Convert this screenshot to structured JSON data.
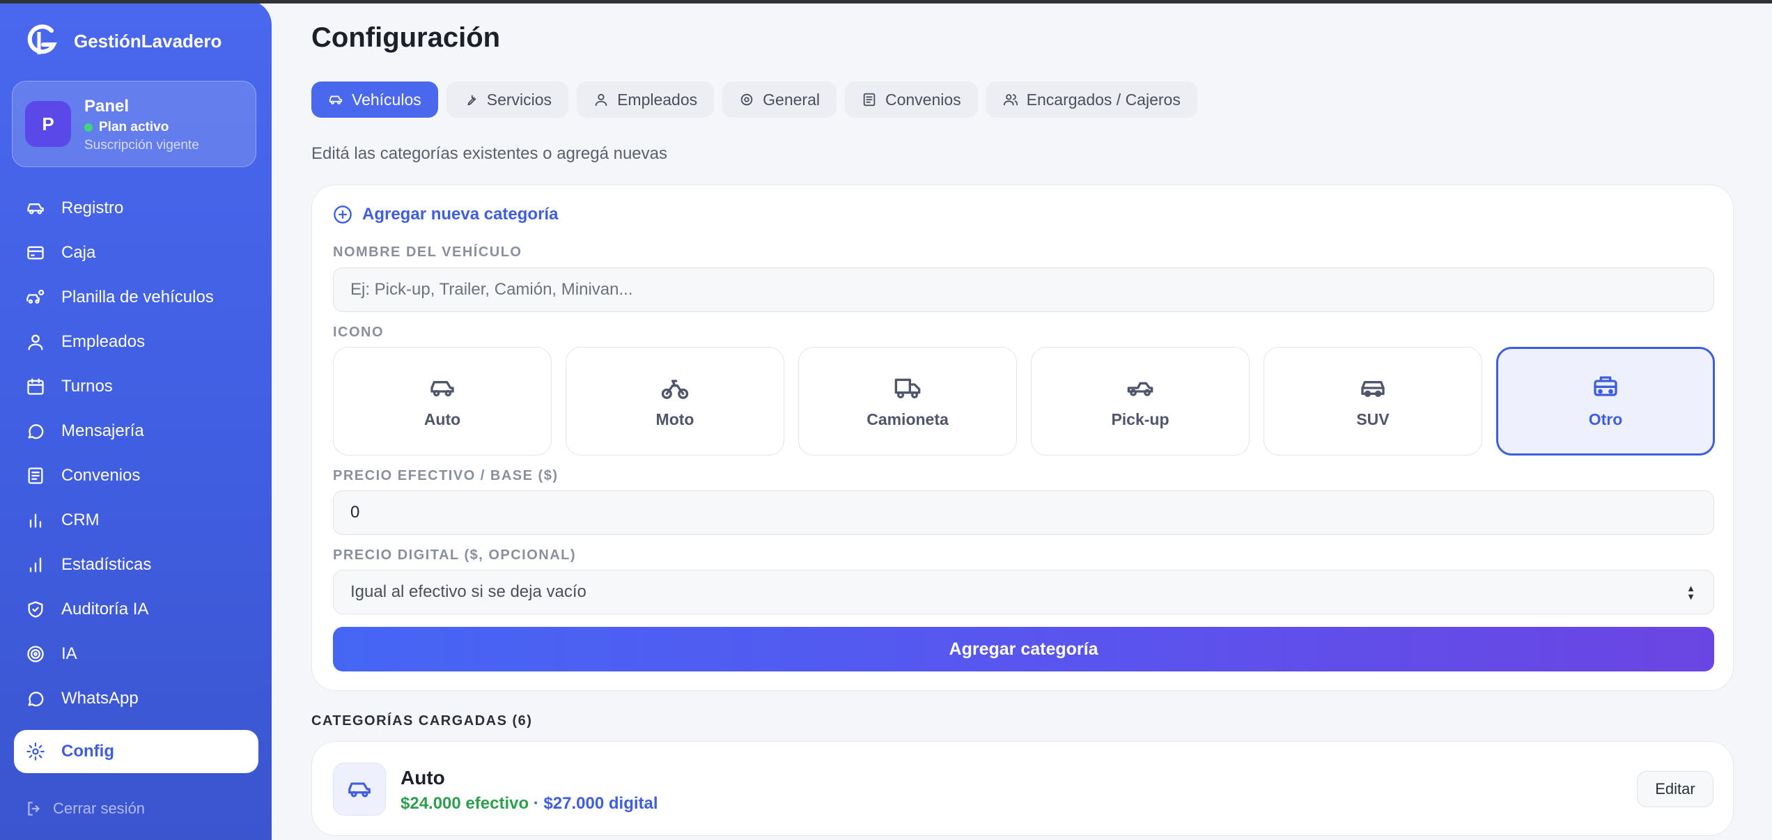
{
  "app": {
    "name": "GestiónLavadero"
  },
  "panel": {
    "avatar": "P",
    "title": "Panel",
    "status": "Plan activo",
    "subtitle": "Suscripción vigente"
  },
  "nav": {
    "items": [
      {
        "label": "Registro",
        "icon": "car-icon"
      },
      {
        "label": "Caja",
        "icon": "credit-card-icon"
      },
      {
        "label": "Planilla de vehículos",
        "icon": "car-settings-icon"
      },
      {
        "label": "Empleados",
        "icon": "user-icon"
      },
      {
        "label": "Turnos",
        "icon": "calendar-icon"
      },
      {
        "label": "Mensajería",
        "icon": "chat-icon"
      },
      {
        "label": "Convenios",
        "icon": "document-icon"
      },
      {
        "label": "CRM",
        "icon": "bar-chart-icon"
      },
      {
        "label": "Estadísticas",
        "icon": "stats-icon"
      },
      {
        "label": "Auditoría IA",
        "icon": "shield-icon"
      },
      {
        "label": "IA",
        "icon": "target-icon"
      },
      {
        "label": "WhatsApp",
        "icon": "chat-icon"
      },
      {
        "label": "Config",
        "icon": "gear-icon",
        "active": true
      }
    ],
    "logout": "Cerrar sesión"
  },
  "page": {
    "title": "Configuración",
    "tabs": [
      "Vehículos",
      "Servicios",
      "Empleados",
      "General",
      "Convenios",
      "Encargados / Cajeros"
    ],
    "active_tab": "Vehículos",
    "subtitle": "Editá las categorías existentes o agregá nuevas"
  },
  "form": {
    "add_link": "Agregar nueva categoría",
    "name_label": "NOMBRE DEL VEHÍCULO",
    "name_placeholder": "Ej: Pick-up, Trailer, Camión, Minivan...",
    "icon_label": "ICONO",
    "icon_options": [
      {
        "label": "Auto",
        "icon": "car-icon"
      },
      {
        "label": "Moto",
        "icon": "motorcycle-icon"
      },
      {
        "label": "Camioneta",
        "icon": "truck-icon"
      },
      {
        "label": "Pick-up",
        "icon": "pickup-icon"
      },
      {
        "label": "SUV",
        "icon": "suv-icon"
      },
      {
        "label": "Otro",
        "icon": "bus-icon",
        "selected": true
      }
    ],
    "cash_price_label": "PRECIO EFECTIVO / BASE ($)",
    "cash_price_value": "0",
    "digital_price_label": "PRECIO DIGITAL ($, OPCIONAL)",
    "digital_price_placeholder": "Igual al efectivo si se deja vacío",
    "submit_label": "Agregar categoría"
  },
  "categories": {
    "title": "CATEGORÍAS CARGADAS (6)",
    "items": [
      {
        "name": "Auto",
        "cash": "$24.000 efectivo",
        "separator": " · ",
        "digital": "$27.000 digital",
        "edit_label": "Editar",
        "icon": "car-icon"
      }
    ]
  },
  "colors": {
    "accent": "#4a68ee",
    "sidebar": "#3f5ddf",
    "cash_price": "#2e9e4f",
    "digital_price": "#3f5ddf"
  }
}
